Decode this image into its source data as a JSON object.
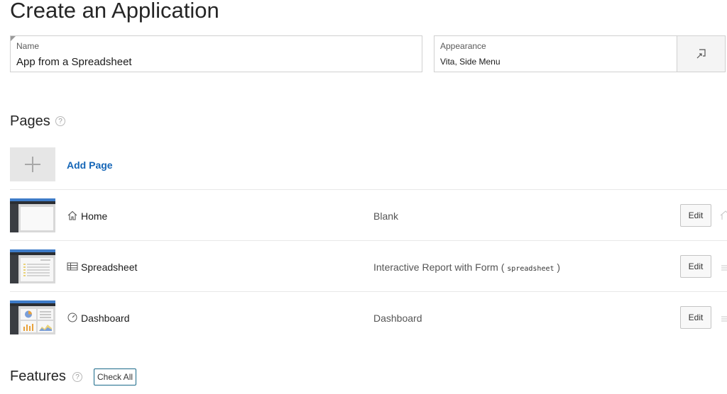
{
  "page": {
    "title": "Create an Application"
  },
  "name_field": {
    "label": "Name",
    "value": "App from a Spreadsheet"
  },
  "appearance_field": {
    "label": "Appearance",
    "value": "Vita, Side Menu",
    "button_icon": "expand-icon"
  },
  "pages_section": {
    "heading": "Pages",
    "help_icon": "?",
    "add_page_label": "Add Page",
    "rows": [
      {
        "name": "Home",
        "icon": "home-icon",
        "type": "Blank",
        "type_extra": "",
        "edit_label": "Edit"
      },
      {
        "name": "Spreadsheet",
        "icon": "table-icon",
        "type": "Interactive Report with Form (",
        "type_extra": "spreadsheet",
        "type_close": ")",
        "edit_label": "Edit"
      },
      {
        "name": "Dashboard",
        "icon": "dashboard-icon",
        "type": "Dashboard",
        "type_extra": "",
        "edit_label": "Edit"
      }
    ]
  },
  "features_section": {
    "heading": "Features",
    "help_icon": "?",
    "check_all_label": "Check All"
  },
  "colors": {
    "accent_link": "#1566b7",
    "thumb_bar": "#3d7bc8",
    "thumb_side": "#3a3d42"
  }
}
